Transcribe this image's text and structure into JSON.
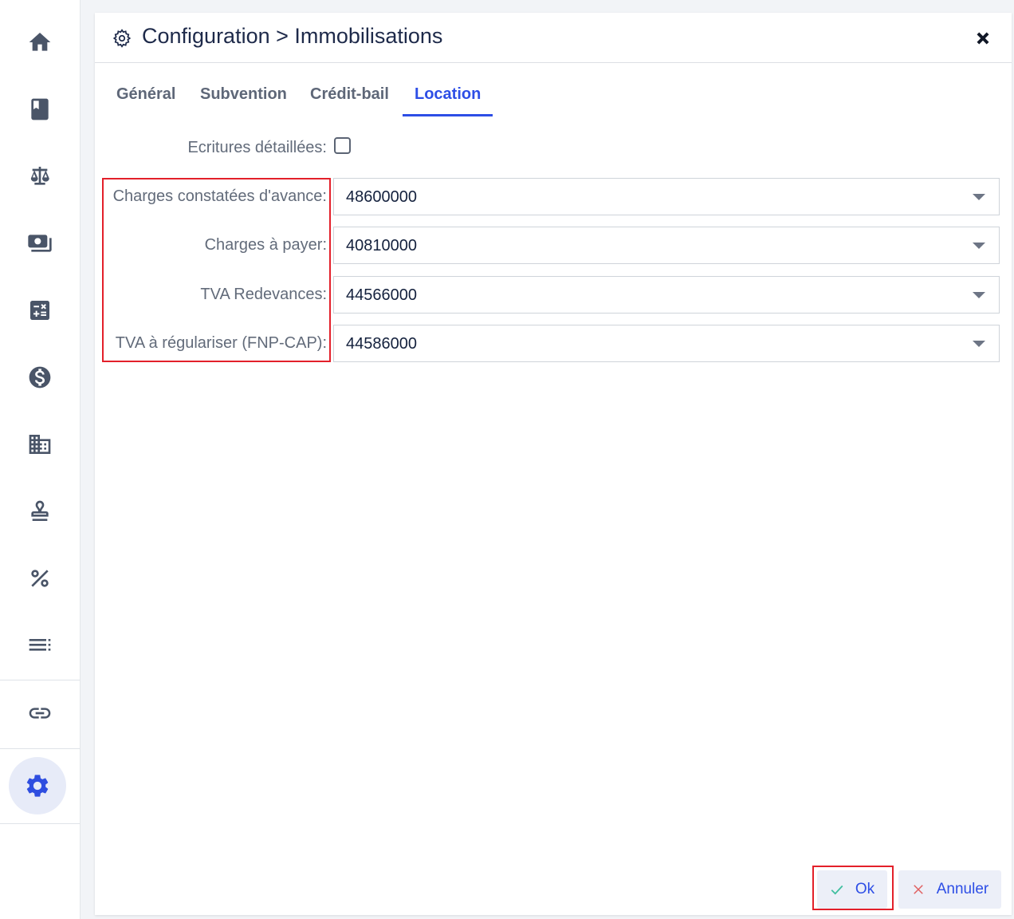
{
  "dialog": {
    "title": "Configuration > Immobilisations",
    "tabs": [
      {
        "label": "Général"
      },
      {
        "label": "Subvention"
      },
      {
        "label": "Crédit-bail"
      },
      {
        "label": "Location"
      }
    ],
    "active_tab": "Location",
    "detailed_entries": {
      "label": "Ecritures détaillées:",
      "checked": false
    },
    "fields": [
      {
        "label": "Charges constatées d'avance:",
        "value": "48600000"
      },
      {
        "label": "Charges à payer:",
        "value": "40810000"
      },
      {
        "label": "TVA Redevances:",
        "value": "44566000"
      },
      {
        "label": "TVA à régulariser (FNP-CAP):",
        "value": "44586000"
      }
    ],
    "ok_label": "Ok",
    "cancel_label": "Annuler"
  },
  "sidebar": {
    "icons": [
      "home-icon",
      "book-icon",
      "balance-scale-icon",
      "money-icon",
      "calculator-icon",
      "dollar-icon",
      "building-icon",
      "stamp-icon",
      "percent-icon",
      "list-icon",
      "link-icon",
      "settings-icon"
    ],
    "active": "settings-icon"
  },
  "colors": {
    "accent": "#2d4ee6",
    "highlight": "#e3202a",
    "ok_check": "#3fbf9f",
    "cancel_x": "#e06060"
  }
}
